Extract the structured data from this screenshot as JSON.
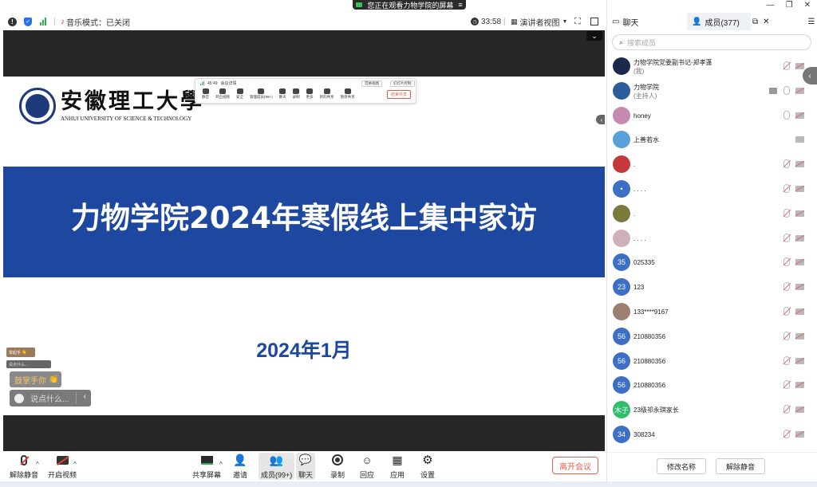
{
  "share_banner": "您正在观看力物学院的屏幕",
  "topbar": {
    "music_mode": "音乐模式：已关闭",
    "timer": "33:58",
    "view_mode": "演讲者视图"
  },
  "slide": {
    "logo_cn": "安徽理工大學",
    "logo_en": "ANHUI UNIVERSITY OF SCIENCE & TECHNOLOGY",
    "title": "力物学院2024年寒假线上集中家访",
    "date": "2024年1月",
    "mini_toolbar": {
      "timer": "45:49",
      "recording": "会议详情",
      "pill1": "宫格视图",
      "pill2": "幻灯片控制",
      "items": [
        "静音",
        "开启视频",
        "安全",
        "管理成员(99+)",
        "聊天",
        "录制",
        "更多",
        "新的共享",
        "暂停共享"
      ],
      "end": "结束共享"
    }
  },
  "reactions": {
    "small1": "举起手",
    "small2": "说点什么...",
    "applause": "鼓掌手你",
    "say_placeholder": "说点什么..."
  },
  "bottombar": {
    "unmute": "解除静音",
    "start_video": "开启视频",
    "share": "共享屏幕",
    "invite": "邀请",
    "members": "成员(99+)",
    "chat": "聊天",
    "record": "录制",
    "reply": "回应",
    "apps": "应用",
    "settings": "设置",
    "leave": "离开会议"
  },
  "panel": {
    "tab_chat": "聊天",
    "tab_members": "成员(377)",
    "search_placeholder": "搜索成员",
    "members": [
      {
        "name": "力物学院党委副书记-郑孝蓬",
        "sub": "(我)",
        "avatar": "",
        "color": "#1b2a4a",
        "mic": "muted",
        "cam": "muted"
      },
      {
        "name": "力物学院",
        "sub": "(主持人)",
        "avatar": "",
        "color": "#2d5c9a",
        "mic": "on",
        "cam": "muted",
        "screen": true
      },
      {
        "name": "honey",
        "sub": "",
        "avatar": "",
        "color": "#c48ab0",
        "mic": "on",
        "cam": "muted"
      },
      {
        "name": "上善若水",
        "sub": "",
        "avatar": "",
        "color": "#5aa0d8",
        "mic": "",
        "cam": "on"
      },
      {
        "name": ".",
        "sub": "",
        "avatar": "",
        "color": "#c43a3a",
        "mic": "muted",
        "cam": "muted"
      },
      {
        "name": ". . . .",
        "sub": "",
        "avatar": "•",
        "color": "#3d6fc5",
        "mic": "muted",
        "cam": "muted"
      },
      {
        "name": ".",
        "sub": "",
        "avatar": "",
        "color": "#7a7a3a",
        "mic": "muted",
        "cam": "muted"
      },
      {
        "name": ". . . .",
        "sub": "",
        "avatar": "",
        "color": "#d0b0b8",
        "mic": "muted",
        "cam": "muted"
      },
      {
        "name": "025335",
        "sub": "",
        "avatar": "35",
        "color": "#3d6fc5",
        "mic": "muted",
        "cam": "muted"
      },
      {
        "name": "123",
        "sub": "",
        "avatar": "23",
        "color": "#3d6fc5",
        "mic": "muted",
        "cam": "muted"
      },
      {
        "name": "133****9167",
        "sub": "",
        "avatar": "",
        "color": "#9a8070",
        "mic": "muted",
        "cam": "muted"
      },
      {
        "name": "210880356",
        "sub": "",
        "avatar": "56",
        "color": "#3d6fc5",
        "mic": "muted",
        "cam": "muted"
      },
      {
        "name": "210880356",
        "sub": "",
        "avatar": "56",
        "color": "#3d6fc5",
        "mic": "muted",
        "cam": "muted"
      },
      {
        "name": "210880356",
        "sub": "",
        "avatar": "56",
        "color": "#3d6fc5",
        "mic": "muted",
        "cam": "muted"
      },
      {
        "name": "23级祁永琪家长",
        "sub": "",
        "avatar": "木子",
        "color": "#2fbf6a",
        "mic": "muted",
        "cam": "muted"
      },
      {
        "name": "308234",
        "sub": "",
        "avatar": "34",
        "color": "#3d6fc5",
        "mic": "muted",
        "cam": "muted"
      }
    ],
    "rename": "修改名称",
    "unmute_btn": "解除静音"
  },
  "colors": {
    "accent": "#1e48a0",
    "leave": "#e8624f",
    "dark": "#262626"
  }
}
